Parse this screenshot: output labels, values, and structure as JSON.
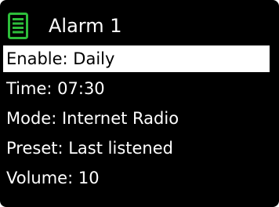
{
  "header": {
    "title": "Alarm 1",
    "icon": "list-icon",
    "icon_color": "#2dbd3a"
  },
  "menu": {
    "items": [
      {
        "label": "Enable: Daily",
        "selected": true
      },
      {
        "label": "Time: 07:30",
        "selected": false
      },
      {
        "label": "Mode: Internet Radio",
        "selected": false
      },
      {
        "label": "Preset: Last listened",
        "selected": false
      },
      {
        "label": "Volume: 10",
        "selected": false
      }
    ]
  },
  "colors": {
    "background": "#000000",
    "text": "#ffffff",
    "highlight_bg": "#ffffff",
    "highlight_text": "#000000"
  }
}
